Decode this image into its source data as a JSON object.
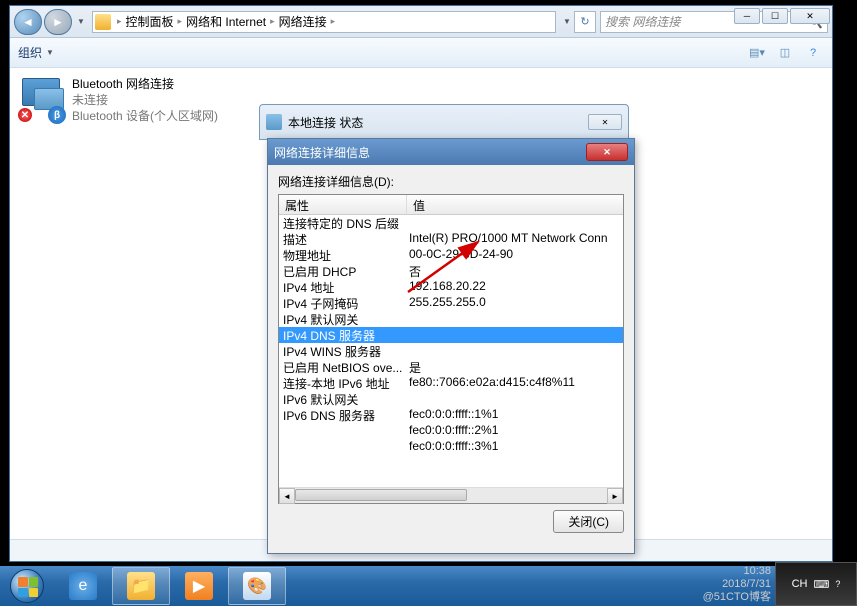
{
  "explorer": {
    "breadcrumb": [
      "控制面板",
      "网络和 Internet",
      "网络连接"
    ],
    "search_placeholder": "搜索 网络连接",
    "organize": "组织",
    "adapter": {
      "name": "Bluetooth 网络连接",
      "status": "未连接",
      "device": "Bluetooth 设备(个人区域网)"
    }
  },
  "status_dialog": {
    "title": "本地连接 状态"
  },
  "details_dialog": {
    "title": "网络连接详细信息",
    "label": "网络连接详细信息(D):",
    "col_property": "属性",
    "col_value": "值",
    "rows": [
      {
        "prop": "连接特定的 DNS 后缀",
        "val": ""
      },
      {
        "prop": "描述",
        "val": "Intel(R) PRO/1000 MT Network Conn"
      },
      {
        "prop": "物理地址",
        "val": "00-0C-29-3D-24-90"
      },
      {
        "prop": "已启用 DHCP",
        "val": "否"
      },
      {
        "prop": "IPv4 地址",
        "val": "192.168.20.22"
      },
      {
        "prop": "IPv4 子网掩码",
        "val": "255.255.255.0"
      },
      {
        "prop": "IPv4 默认网关",
        "val": ""
      },
      {
        "prop": "IPv4 DNS 服务器",
        "val": "",
        "selected": true
      },
      {
        "prop": "IPv4 WINS 服务器",
        "val": ""
      },
      {
        "prop": "已启用 NetBIOS ove...",
        "val": "是"
      },
      {
        "prop": "连接-本地 IPv6 地址",
        "val": "fe80::7066:e02a:d415:c4f8%11"
      },
      {
        "prop": "IPv6 默认网关",
        "val": ""
      },
      {
        "prop": "IPv6 DNS 服务器",
        "val": "fec0:0:0:ffff::1%1"
      },
      {
        "prop": "",
        "val": "fec0:0:0:ffff::2%1"
      },
      {
        "prop": "",
        "val": "fec0:0:0:ffff::3%1"
      }
    ],
    "close_btn": "关闭(C)"
  },
  "taskbar": {
    "lang": "CH",
    "time": "10:38",
    "date": "2018/7/31"
  },
  "watermark": "@51CTO博客"
}
